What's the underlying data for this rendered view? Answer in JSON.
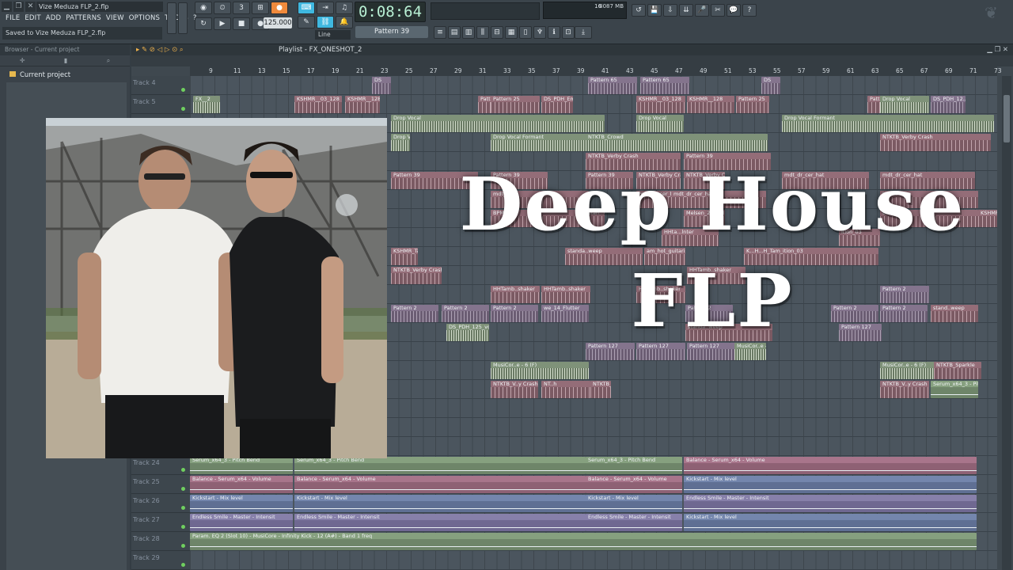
{
  "window": {
    "title": "Vize Meduza FLP_2.flp"
  },
  "menu": [
    "FILE",
    "EDIT",
    "ADD",
    "PATTERNS",
    "VIEW",
    "OPTIONS",
    "TOOLS",
    "?"
  ],
  "hint": "Saved to Vize Meduza FLP_2.flp",
  "transport": {
    "time": "0:08:64",
    "tempo": "125.000",
    "pattern": "Pattern 39",
    "snap": "Line",
    "cpu": "16",
    "memory": "8087 MB"
  },
  "browser": {
    "header": "Browser - Current project",
    "item": "Current project"
  },
  "playlist": {
    "title": "Playlist - FX_ONESHOT_2",
    "bars": [
      "9",
      "11",
      "13",
      "15",
      "17",
      "19",
      "21",
      "23",
      "25",
      "27",
      "29",
      "31",
      "33",
      "35",
      "37",
      "39",
      "41",
      "43",
      "45",
      "47",
      "49",
      "51",
      "53",
      "55",
      "57",
      "59",
      "61",
      "63",
      "65",
      "67",
      "69",
      "71",
      "73"
    ],
    "tracks": [
      {
        "name": "Track 4"
      },
      {
        "name": "Track 5"
      },
      {
        "name": ""
      },
      {
        "name": ""
      },
      {
        "name": ""
      },
      {
        "name": ""
      },
      {
        "name": ""
      },
      {
        "name": ""
      },
      {
        "name": ""
      },
      {
        "name": ""
      },
      {
        "name": ""
      },
      {
        "name": ""
      },
      {
        "name": ""
      },
      {
        "name": ""
      },
      {
        "name": ""
      },
      {
        "name": ""
      },
      {
        "name": ""
      },
      {
        "name": ""
      },
      {
        "name": ""
      },
      {
        "name": ""
      },
      {
        "name": "Track 24"
      },
      {
        "name": "Track 25"
      },
      {
        "name": "Track 26"
      },
      {
        "name": "Track 27"
      },
      {
        "name": "Track 28"
      },
      {
        "name": "Track 29"
      }
    ],
    "clips": [
      {
        "label": "DS",
        "style": "c-pat"
      },
      {
        "label": "Pattern 65",
        "style": "c-pat"
      },
      {
        "label": "Pattern 65",
        "style": "c-pat"
      },
      {
        "label": "DS",
        "style": "c-pat"
      },
      {
        "label": "FX__2",
        "style": "c-audio"
      },
      {
        "label": "KSHMR__03_128",
        "style": "c-pink"
      },
      {
        "label": "KSHMR__128",
        "style": "c-pink"
      },
      {
        "label": "Pattern 25",
        "style": "c-pink"
      },
      {
        "label": "Pattern 25",
        "style": "c-pink"
      },
      {
        "label": "DS_PDH_Emin #3",
        "style": "c-pink"
      },
      {
        "label": "KSHMR__03_128",
        "style": "c-pink"
      },
      {
        "label": "KSHMR__128",
        "style": "c-pink"
      },
      {
        "label": "Pattern 25",
        "style": "c-pink"
      },
      {
        "label": "Pattern 25",
        "style": "c-pink"
      },
      {
        "label": "Drop Vocal",
        "style": "c-audio"
      },
      {
        "label": "DS_PDH_12..pler",
        "style": "c-pat"
      },
      {
        "label": "Drop Vocal",
        "style": "c-audio"
      },
      {
        "label": "Drop Vocal",
        "style": "c-audio"
      },
      {
        "label": "Drop Vocal Formant",
        "style": "c-audio"
      },
      {
        "label": "Drop Vocal Formant",
        "style": "c-audio"
      },
      {
        "label": "Drop Vocal Formant",
        "style": "c-audio"
      },
      {
        "label": "NTKTB_Crowd",
        "style": "c-audio"
      },
      {
        "label": "NTKTB_Verby Crash",
        "style": "c-pink"
      },
      {
        "label": "NTKTB_Verby Crash",
        "style": "c-pink"
      },
      {
        "label": "Pattern 39",
        "style": "c-pink"
      },
      {
        "label": "Pattern 39",
        "style": "c-pink"
      },
      {
        "label": "Pattern 39",
        "style": "c-pink"
      },
      {
        "label": "Pattern 39",
        "style": "c-pink"
      },
      {
        "label": "NTKTB_Verby Crash",
        "style": "c-pink"
      },
      {
        "label": "NTKTB_Verby Crash",
        "style": "c-pink"
      },
      {
        "label": "mdt_dr_cer_hat",
        "style": "c-pink"
      },
      {
        "label": "mdt_dr_cer_hat",
        "style": "c-pink"
      },
      {
        "label": "mdt_hat",
        "style": "c-pink"
      },
      {
        "label": "mdt_dr_cer_hat",
        "style": "c-pink"
      },
      {
        "label": "mdt_dr_cer_hat",
        "style": "c-pink"
      },
      {
        "label": "KSHM",
        "style": "c-pink"
      },
      {
        "label": "Melsen_24BPM",
        "style": "c-pink"
      },
      {
        "label": "BPM",
        "style": "c-pink"
      },
      {
        "label": "stan...ong sweep",
        "style": "c-pink"
      },
      {
        "label": "Melsen_24BPM",
        "style": "c-pink"
      },
      {
        "label": "BPM",
        "style": "c-pink"
      },
      {
        "label": "KSHMR_Tam_ition_03",
        "style": "c-pink"
      },
      {
        "label": "HHta...lnter",
        "style": "c-pink"
      },
      {
        "label": "ition_03",
        "style": "c-pink"
      },
      {
        "label": "KSHMR_Tam",
        "style": "c-pink"
      },
      {
        "label": "K...H...H_Tam_ition_03",
        "style": "c-pink"
      },
      {
        "label": "standa..weep",
        "style": "c-pink"
      },
      {
        "label": "am_hot_guitarish_8",
        "style": "c-pink"
      },
      {
        "label": "NTKTB_Verby Crash",
        "style": "c-pink"
      },
      {
        "label": "HHTamb..shaker",
        "style": "c-pink"
      },
      {
        "label": "HHTamb..shaker",
        "style": "c-pink"
      },
      {
        "label": "HHTamb..shaker",
        "style": "c-pink"
      },
      {
        "label": "HHTamb..shaker",
        "style": "c-pink"
      },
      {
        "label": "Pattern 2",
        "style": "c-pat"
      },
      {
        "label": "Pattern 2",
        "style": "c-pat"
      },
      {
        "label": "Pattern 2",
        "style": "c-pat"
      },
      {
        "label": "Pattern 2",
        "style": "c-pat"
      },
      {
        "label": "we_14_Flutter",
        "style": "c-pat"
      },
      {
        "label": "Pattern 2",
        "style": "c-pat"
      },
      {
        "label": "Pattern 2",
        "style": "c-pat"
      },
      {
        "label": "Pattern 2",
        "style": "c-pat"
      },
      {
        "label": "stand..weep",
        "style": "c-pink"
      },
      {
        "label": "DS_PDH_125_vo..wet_Emin #3",
        "style": "c-audio"
      },
      {
        "label": "standa..weep",
        "style": "c-pink"
      },
      {
        "label": "Pattern 127",
        "style": "c-pat"
      },
      {
        "label": "Pattern 127",
        "style": "c-pat"
      },
      {
        "label": "Pattern 127",
        "style": "c-pat"
      },
      {
        "label": "Pattern 127",
        "style": "c-pat"
      },
      {
        "label": "MusiCor..e - 6 (F)",
        "style": "c-audio"
      },
      {
        "label": "MusiCor..e - 6 (F)",
        "style": "c-audio"
      },
      {
        "label": "MusiCor..e - 6 (F)",
        "style": "c-audio"
      },
      {
        "label": "MusiCor..e - 6 (F)",
        "style": "c-audio"
      },
      {
        "label": "NTKTB_Sparkle",
        "style": "c-pink"
      },
      {
        "label": "NTKTB_V..y Crash",
        "style": "c-pink"
      },
      {
        "label": "NT..h",
        "style": "c-pink"
      },
      {
        "label": "NTKTB_Sparkle",
        "style": "c-pink"
      },
      {
        "label": "NTKTB_V..y Crash",
        "style": "c-pink"
      },
      {
        "label": "Serum_x64_3 - Pitch Bend",
        "style": "c-auto-green"
      },
      {
        "label": "Serum_x64_3 - Pitch Bend",
        "style": "c-auto-green"
      },
      {
        "label": "Serum_x64_3 - Pitch Bend",
        "style": "c-auto-green"
      },
      {
        "label": "Serum_x64_3 - Pitch Bend",
        "style": "c-auto-green"
      },
      {
        "label": "Balance - Serum_x64 - Volume",
        "style": "c-auto-pink"
      },
      {
        "label": "Balance - Serum_x64 - Volume",
        "style": "c-auto-pink"
      },
      {
        "label": "Balance - Serum_x64 - Volume",
        "style": "c-auto-pink"
      },
      {
        "label": "Balance - Serum_x64 - Volume",
        "style": "c-auto-pink"
      },
      {
        "label": "Kickstart - Mix level",
        "style": "c-auto-blue"
      },
      {
        "label": "Kickstart - Mix level",
        "style": "c-auto-blue"
      },
      {
        "label": "Kickstart - Mix level",
        "style": "c-auto-blue"
      },
      {
        "label": "Kickstart - Mix level",
        "style": "c-auto-blue"
      },
      {
        "label": "Endless Smile - Master - Intensit",
        "style": "c-auto-purple"
      },
      {
        "label": "Endless Smile - Master - Intensit",
        "style": "c-auto-purple"
      },
      {
        "label": "Endless Smile - Master - Intensit",
        "style": "c-auto-purple"
      },
      {
        "label": "Endless Smile - Master - Intensit",
        "style": "c-auto-purple"
      },
      {
        "label": "Kickstart - Mix level",
        "style": "c-auto-blue"
      },
      {
        "label": "Param. EQ 2 (Slot 10) - MusiCore - Infinity Kick - 12 (A#) - Band 1 freq",
        "style": "c-auto-green"
      }
    ]
  },
  "overlay": {
    "line1": "Deep House",
    "line2": "FLP"
  },
  "colors": {
    "accent_orange": "#f08a3c",
    "accent_blue": "#3fb8e0",
    "folder": "#e6b84e"
  }
}
